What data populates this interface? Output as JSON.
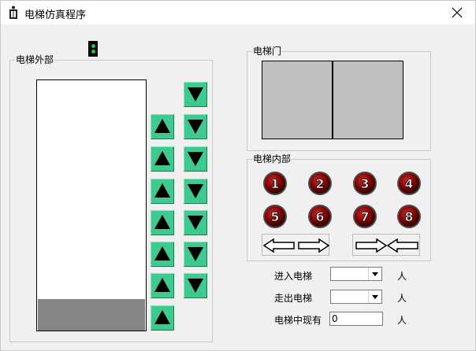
{
  "window": {
    "title": "电梯仿真程序",
    "app_icon": "elevator-app-icon",
    "close_icon": "close-icon"
  },
  "outside": {
    "label": "电梯外部",
    "indicator_state": "green",
    "down_buttons": 7,
    "up_buttons": 7
  },
  "door": {
    "label": "电梯门",
    "state": "closed"
  },
  "inside": {
    "label": "电梯内部",
    "floor_buttons": [
      "1",
      "2",
      "3",
      "4",
      "5",
      "6",
      "7",
      "8"
    ],
    "open_door_icon": "door-open-arrows-icon",
    "close_door_icon": "door-close-arrows-icon"
  },
  "controls": {
    "enter_label": "进入电梯",
    "exit_label": "走出电梯",
    "current_label": "电梯中现有",
    "enter_value": "",
    "exit_value": "",
    "current_value": "0",
    "unit": "人"
  },
  "colors": {
    "arrow_button": "#3ec98f",
    "car": "#858585",
    "door": "#c0c0c0",
    "floor_button": "#8b0000"
  }
}
